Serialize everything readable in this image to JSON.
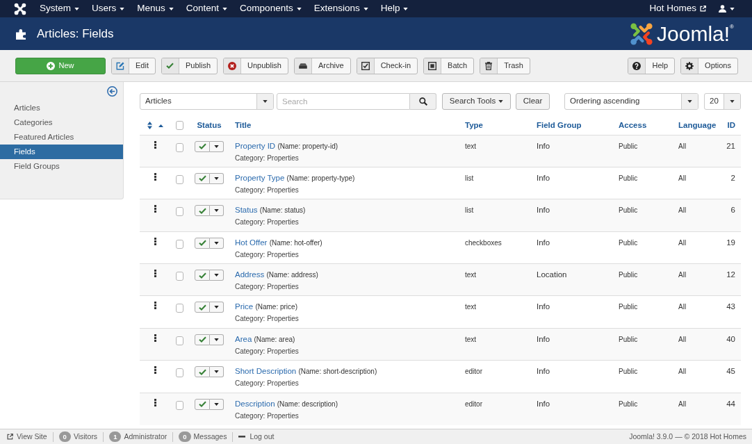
{
  "top_menu": {
    "items": [
      {
        "label": "System"
      },
      {
        "label": "Users"
      },
      {
        "label": "Menus"
      },
      {
        "label": "Content"
      },
      {
        "label": "Components"
      },
      {
        "label": "Extensions"
      },
      {
        "label": "Help"
      }
    ],
    "site_link": "Hot Homes"
  },
  "header": {
    "title": "Articles: Fields",
    "logo_text": "Joomla!$^{®}$"
  },
  "toolbar": {
    "buttons": [
      {
        "kind": "new",
        "label": "New"
      },
      {
        "kind": "edit",
        "label": "Edit"
      },
      {
        "kind": "publish",
        "label": "Publish"
      },
      {
        "kind": "unpublish",
        "label": "Unpublish"
      },
      {
        "kind": "archive",
        "label": "Archive"
      },
      {
        "kind": "checkin",
        "label": "Check-in"
      },
      {
        "kind": "batch",
        "label": "Batch"
      },
      {
        "kind": "trash",
        "label": "Trash"
      }
    ],
    "right_buttons": [
      {
        "kind": "help",
        "label": "Help"
      },
      {
        "kind": "options",
        "label": "Options"
      }
    ]
  },
  "sidebar": {
    "items": [
      {
        "label": "Articles",
        "selected": false
      },
      {
        "label": "Categories",
        "selected": false
      },
      {
        "label": "Featured Articles",
        "selected": false
      },
      {
        "label": "Fields",
        "selected": true
      },
      {
        "label": "Field Groups",
        "selected": false
      }
    ]
  },
  "filters": {
    "context": "Articles",
    "search": {
      "placeholder": "Search"
    },
    "search_tools": "Search Tools",
    "clear": "Clear",
    "ordering": "Ordering ascending",
    "limit": "20"
  },
  "table": {
    "header_checked": false,
    "columns": [
      "Status",
      "Title",
      "Type",
      "Field Group",
      "Access",
      "Language",
      "ID"
    ],
    "rows": [
      {
        "title": "Property ID",
        "name": "(Name: property-id)",
        "category": "Category: Properties",
        "type": "text",
        "field_group": "Info",
        "access": "Public",
        "language": "All",
        "id": "21",
        "published": true,
        "checked": false
      },
      {
        "title": "Property Type",
        "name": "(Name: property-type)",
        "category": "Category: Properties",
        "type": "list",
        "field_group": "Info",
        "access": "Public",
        "language": "All",
        "id": "2",
        "published": true,
        "checked": false
      },
      {
        "title": "Status",
        "name": "(Name: status)",
        "category": "Category: Properties",
        "type": "list",
        "field_group": "Info",
        "access": "Public",
        "language": "All",
        "id": "6",
        "published": true,
        "checked": false
      },
      {
        "title": "Hot Offer",
        "name": "(Name: hot-offer)",
        "category": "Category: Properties",
        "type": "checkboxes",
        "field_group": "Info",
        "access": "Public",
        "language": "All",
        "id": "19",
        "published": true,
        "checked": false
      },
      {
        "title": "Address",
        "name": "(Name: address)",
        "category": "Category: Properties",
        "type": "text",
        "field_group": "Location",
        "access": "Public",
        "language": "All",
        "id": "12",
        "published": true,
        "checked": false
      },
      {
        "title": "Price",
        "name": "(Name: price)",
        "category": "Category: Properties",
        "type": "text",
        "field_group": "Info",
        "access": "Public",
        "language": "All",
        "id": "43",
        "published": true,
        "checked": false
      },
      {
        "title": "Area",
        "name": "(Name: area)",
        "category": "Category: Properties",
        "type": "text",
        "field_group": "Info",
        "access": "Public",
        "language": "All",
        "id": "40",
        "published": true,
        "checked": false
      },
      {
        "title": "Short Description",
        "name": "(Name: short-description)",
        "category": "Category: Properties",
        "type": "editor",
        "field_group": "Info",
        "access": "Public",
        "language": "All",
        "id": "45",
        "published": true,
        "checked": false
      },
      {
        "title": "Description",
        "name": "(Name: description)",
        "category": "Category: Properties",
        "type": "editor",
        "field_group": "Info",
        "access": "Public",
        "language": "All",
        "id": "44",
        "published": true,
        "checked": false
      }
    ]
  },
  "status_bar": {
    "items": [
      {
        "kind": "link",
        "label": "View Site"
      },
      {
        "kind": "count",
        "count": "0",
        "label": "Visitors"
      },
      {
        "kind": "count",
        "count": "1",
        "label": "Administrator"
      },
      {
        "kind": "count",
        "count": "0",
        "label": "Messages"
      },
      {
        "kind": "logout",
        "label": "Log out"
      }
    ],
    "credit": "Joomla! 3.9.0 — © 2018 Hot Homes"
  }
}
